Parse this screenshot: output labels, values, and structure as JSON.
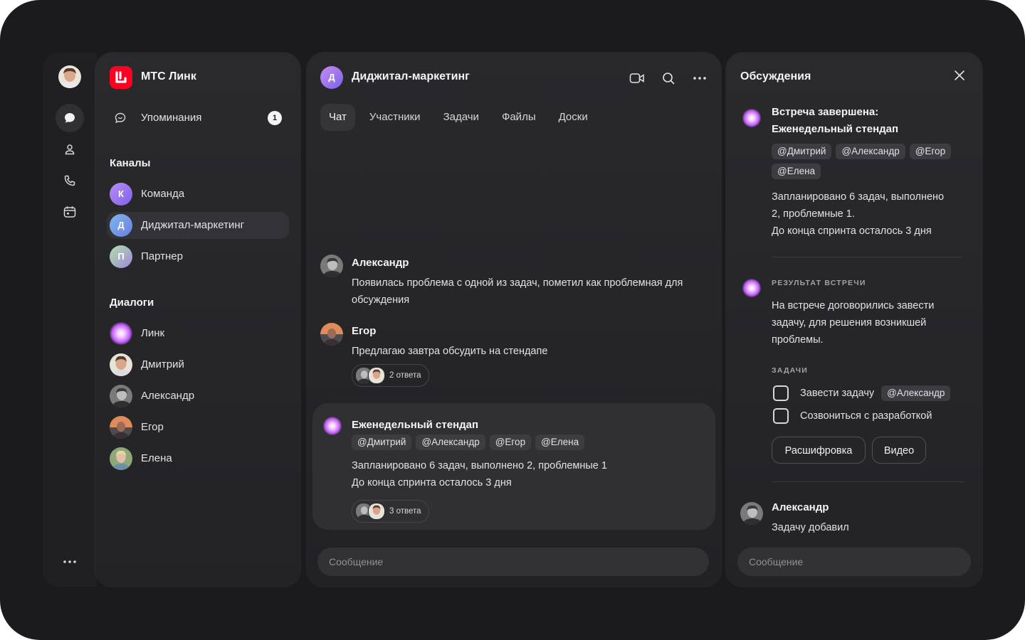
{
  "app": {
    "name": "МТС Линк",
    "brand_color": "#ff0023"
  },
  "sidebar": {
    "mentions_label": "Упоминания",
    "mentions_count": "1",
    "channels_title": "Каналы",
    "channels": [
      {
        "initial": "К",
        "label": "Команда",
        "color": "#8c6cf0"
      },
      {
        "initial": "Д",
        "label": "Диджитал-маркетинг",
        "color": "#6f9de8"
      },
      {
        "initial": "П",
        "label": "Партнер",
        "color": "#9d8ad6"
      }
    ],
    "dialogs_title": "Диалоги",
    "dialogs": [
      {
        "label": "Линк"
      },
      {
        "label": "Дмитрий"
      },
      {
        "label": "Александр"
      },
      {
        "label": "Егор"
      },
      {
        "label": "Елена"
      }
    ]
  },
  "chat": {
    "avatar_initial": "Д",
    "title": "Диджитал-маркетинг",
    "tabs": [
      "Чат",
      "Участники",
      "Задачи",
      "Файлы",
      "Доски"
    ],
    "messages": [
      {
        "author": "Александр",
        "text": "Появилась проблема с одной из задач, пометил как проблемная для обсуждения"
      },
      {
        "author": "Егор",
        "text": "Предлагаю завтра обсудить на стендапе",
        "replies": "2 ответа"
      }
    ],
    "meeting": {
      "title": "Еженедельный стендап",
      "tags": [
        "@Дмитрий",
        "@Александр",
        "@Егор",
        "@Елена"
      ],
      "line1": "Запланировано 6 задач, выполнено 2, проблемные 1",
      "line2": "До конца спринта осталось 3 дня",
      "replies": "3 ответа"
    },
    "input_placeholder": "Сообщение"
  },
  "discussions": {
    "title": "Обсуждения",
    "summary_title_1": "Встреча завершена:",
    "summary_title_2": "Еженедельный стендап",
    "tags": [
      "@Дмитрий",
      "@Александр",
      "@Егор",
      "@Елена"
    ],
    "summary_line1": "Запланировано 6 задач, выполнено",
    "summary_line2": "2, проблемные 1.",
    "summary_line3": "До конца спринта осталось 3 дня",
    "result_caption": "РЕЗУЛЬТАТ ВСТРЕЧИ",
    "result_line1": "На встрече договорились завести",
    "result_line2": "задачу,  для решения возникшей",
    "result_line3": "проблемы.",
    "tasks_caption": "ЗАДАЧИ",
    "tasks": [
      {
        "label": "Завести задачу",
        "tag": "@Александр"
      },
      {
        "label": "Созвониться с разработкой",
        "tag": ""
      }
    ],
    "buttons": [
      "Расшифровка",
      "Видео"
    ],
    "reply_author": "Александр",
    "reply_text": "Задачу добавил",
    "input_placeholder": "Сообщение"
  }
}
